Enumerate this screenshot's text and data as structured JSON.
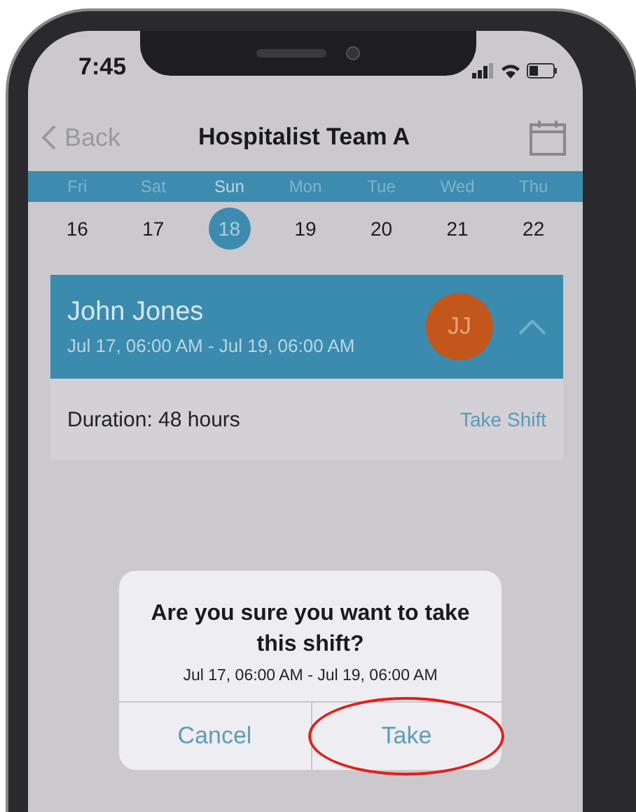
{
  "status_bar": {
    "time": "7:45"
  },
  "nav": {
    "back": "Back",
    "title": "Hospitalist Team A"
  },
  "calendar": [
    {
      "weekday": "Fri",
      "date": "16",
      "selected": false
    },
    {
      "weekday": "Sat",
      "date": "17",
      "selected": false
    },
    {
      "weekday": "Sun",
      "date": "18",
      "selected": true
    },
    {
      "weekday": "Mon",
      "date": "19",
      "selected": false
    },
    {
      "weekday": "Tue",
      "date": "20",
      "selected": false
    },
    {
      "weekday": "Wed",
      "date": "21",
      "selected": false
    },
    {
      "weekday": "Thu",
      "date": "22",
      "selected": false
    }
  ],
  "shift_card": {
    "name": "John Jones",
    "range": "Jul 17, 06:00 AM - Jul 19, 06:00 AM",
    "initials": "JJ",
    "expanded": true,
    "duration": "Duration: 48 hours",
    "action": "Take Shift"
  },
  "dialog": {
    "message": "Are you sure you want to take this shift?",
    "detail": "Jul 17, 06:00 AM - Jul 19, 06:00 AM",
    "buttons": [
      {
        "label": "Cancel",
        "circled": false
      },
      {
        "label": "Take",
        "circled": true
      }
    ]
  }
}
